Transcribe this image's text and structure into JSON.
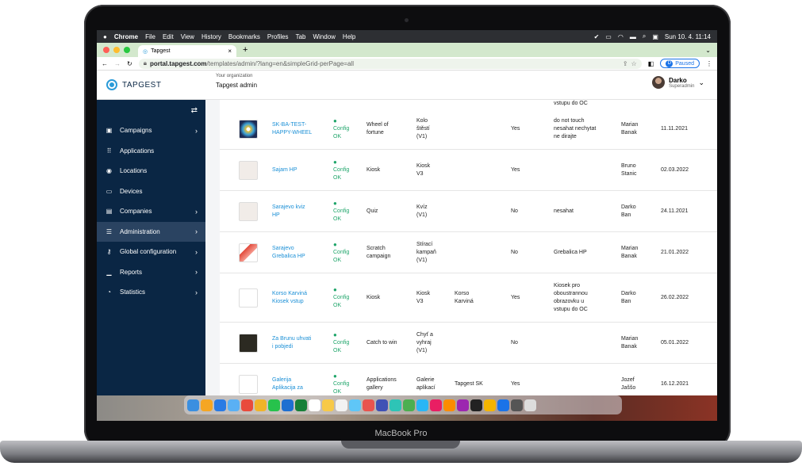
{
  "device_label": "MacBook Pro",
  "menubar": {
    "apple": "",
    "app": "Chrome",
    "items": [
      "File",
      "Edit",
      "View",
      "History",
      "Bookmarks",
      "Profiles",
      "Tab",
      "Window",
      "Help"
    ],
    "clock": "Sun 10. 4.  11:14"
  },
  "browser": {
    "tab_title": "Tapgest",
    "tab_close": "×",
    "new_tab": "+",
    "url_host": "portal.tapgest.com",
    "url_path": "/templates/admin/?lang=en&simpleGrid-perPage=all",
    "profile_initial": "D",
    "profile_status": "Paused"
  },
  "app": {
    "logo": "TAPGEST",
    "org_label": "Your organization",
    "org_name": "Tapgest admin",
    "user_name": "Darko",
    "user_role": "Superadmin",
    "sidebar": [
      {
        "label": "Campaigns",
        "icon": "image-icon",
        "chevron": "›"
      },
      {
        "label": "Applications",
        "icon": "grid-icon",
        "chevron": ""
      },
      {
        "label": "Locations",
        "icon": "location-icon",
        "chevron": ""
      },
      {
        "label": "Devices",
        "icon": "monitor-icon",
        "chevron": ""
      },
      {
        "label": "Companies",
        "icon": "building-icon",
        "chevron": "›"
      },
      {
        "label": "Administration",
        "icon": "sliders-icon",
        "chevron": "›",
        "active": true
      },
      {
        "label": "Global configuration",
        "icon": "key-icon",
        "chevron": "›"
      },
      {
        "label": "Reports",
        "icon": "chart-icon",
        "chevron": "›"
      },
      {
        "label": "Statistics",
        "icon": "pie-icon",
        "chevron": "›"
      }
    ],
    "top_partial_text": "vstupu do OC",
    "rows": [
      {
        "name": "SK-BA-TEST-\nHAPPY-WHEEL",
        "status": "Config\nOK",
        "type": "Wheel of\nfortune",
        "template": "Kolo\nštěstí\n(V1)",
        "location": "",
        "active": "Yes",
        "note": "do not touch\nnesahat nechytat\nne dirajte",
        "owner": "Marian\nBanak",
        "date": "11.11.2021",
        "thumb": "wheel"
      },
      {
        "name": "Sajam HP",
        "status": "Config\nOK",
        "type": "Kiosk",
        "template": "Kiosk\nV3",
        "location": "",
        "active": "Yes",
        "note": "",
        "owner": "Bruno\nStanic",
        "date": "02.03.2022",
        "thumb": "hp"
      },
      {
        "name": "Sarajevo kviz\nHP",
        "status": "Config\nOK",
        "type": "Quiz",
        "template": "Kvíz\n(V1)",
        "location": "",
        "active": "No",
        "note": "nesahat",
        "owner": "Darko\nBan",
        "date": "24.11.2021",
        "thumb": "hp"
      },
      {
        "name": "Sarajevo\nGrebalica HP",
        "status": "Config\nOK",
        "type": "Scratch\ncampaign",
        "template": "Stírací\nkampaň\n(V1)",
        "location": "",
        "active": "No",
        "note": "Grebalica HP",
        "owner": "Marian\nBanak",
        "date": "21.01.2022",
        "thumb": "eraser"
      },
      {
        "name": "Korso Karviná\nKiosek vstup",
        "status": "Config\nOK",
        "type": "Kiosk",
        "template": "Kiosk\nV3",
        "location": "Korso\nKarviná",
        "active": "Yes",
        "note": "Kiosek pro\noboustrannou\nobrazovku u\nvstupu do OC",
        "owner": "Darko\nBan",
        "date": "26.02.2022",
        "thumb": "korso"
      },
      {
        "name": "Za Brunu uhvati\ni pobjedi",
        "status": "Config\nOK",
        "type": "Catch to win",
        "template": "Chyť a\nvyhraj\n(V1)",
        "location": "",
        "active": "No",
        "note": "",
        "owner": "Marian\nBanak",
        "date": "05.01.2022",
        "thumb": "dark"
      },
      {
        "name": "Galerija\nAplikacija za",
        "status": "Config\nOK",
        "type": "Applications\ngallery",
        "template": "Galerie\naplikací",
        "location": "Tapgest SK",
        "active": "Yes",
        "note": "",
        "owner": "Jozef\nJaššo",
        "date": "16.12.2021",
        "thumb": "tapgest"
      }
    ],
    "scroll_top": "↑"
  }
}
